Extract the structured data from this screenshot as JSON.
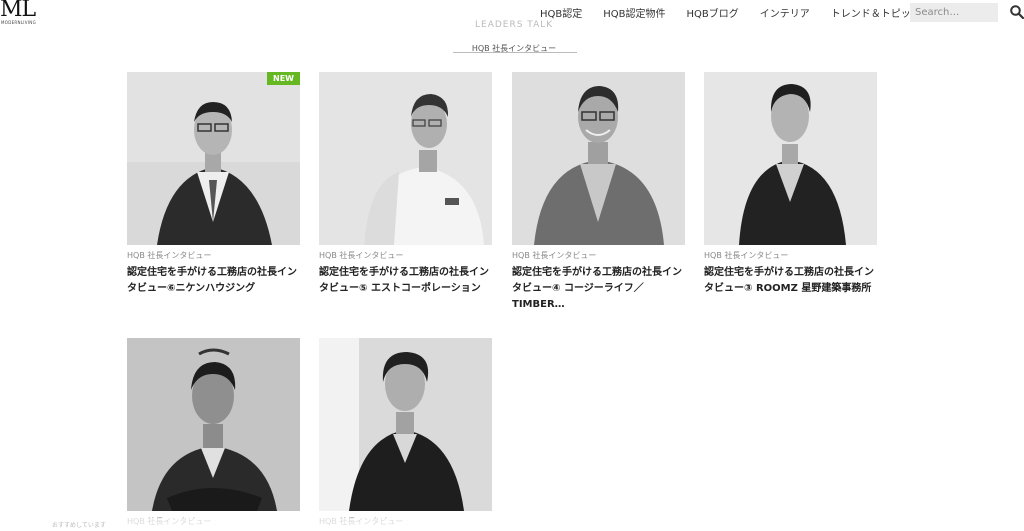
{
  "header": {
    "logo_text": "ML",
    "logo_sub": "MODERNLIVING",
    "nav": [
      "HQB認定",
      "HQB認定物件",
      "HQBブログ",
      "インテリア",
      "トレンド＆トピックス"
    ],
    "search_placeholder": "Search…"
  },
  "section": {
    "faded_heading": "LEADERS TALK",
    "title": "HQB 社長インタビュー"
  },
  "cards": [
    {
      "category": "HQB 社長インタビュー",
      "title": "認定住宅を手がける工務店の社長インタビュー⑥ニケンハウジング",
      "badge": "NEW"
    },
    {
      "category": "HQB 社長インタビュー",
      "title": "認定住宅を手がける工務店の社長インタビュー⑤ エストコーポレーション"
    },
    {
      "category": "HQB 社長インタビュー",
      "title": "認定住宅を手がける工務店の社長インタビュー④ コージーライフ／TIMBER…"
    },
    {
      "category": "HQB 社長インタビュー",
      "title": "認定住宅を手がける工務店の社長インタビュー③ ROOMZ 星野建築事務所"
    },
    {
      "category": "HQB 社長インタビュー",
      "title": ""
    },
    {
      "category": "HQB 社長インタビュー",
      "title": ""
    }
  ],
  "footer": {
    "partial_text": "おすすめしています"
  }
}
